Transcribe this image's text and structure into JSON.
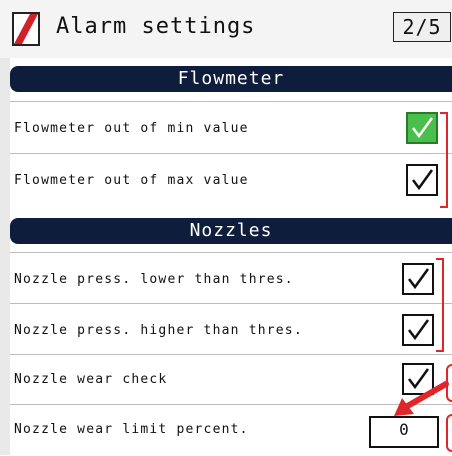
{
  "header": {
    "title": "Alarm settings",
    "page_indicator": "2/5",
    "logo_icon": "red-slash-logo"
  },
  "sections": [
    {
      "title": "Flowmeter",
      "rows": [
        {
          "label": "Flowmeter out of min value",
          "checked": true
        },
        {
          "label": "Flowmeter out of max value",
          "checked": true
        }
      ]
    },
    {
      "title": "Nozzles",
      "rows": [
        {
          "label": "Nozzle press. lower than thres.",
          "checked": true
        },
        {
          "label": "Nozzle press. higher than thres.",
          "checked": true
        },
        {
          "label": "Nozzle wear check",
          "checked": true
        },
        {
          "label": "Nozzle wear limit percent.",
          "value": "0"
        }
      ]
    }
  ],
  "colors": {
    "section_header_bg": "#0f1d3d",
    "checkbox_selected_bg": "#4bbf4b",
    "annotation_red": "#e0262a"
  }
}
